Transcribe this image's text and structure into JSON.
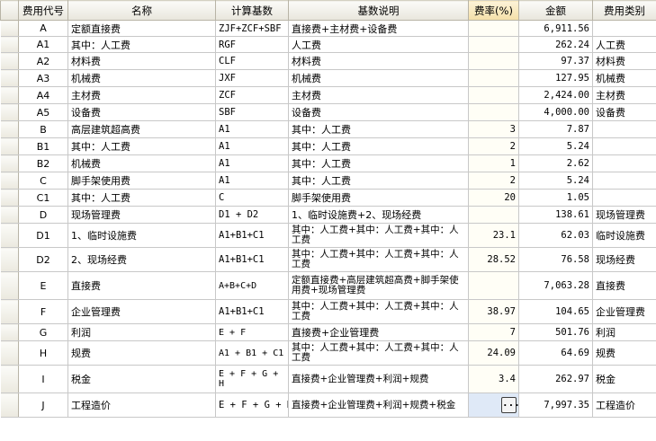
{
  "headers": {
    "code": "费用代号",
    "name": "名称",
    "base": "计算基数",
    "desc": "基数说明",
    "rate": "费率(%)",
    "amount": "金额",
    "category": "费用类别"
  },
  "rows": [
    {
      "code": "A",
      "name": "定额直接费",
      "base": "ZJF+ZCF+SBF",
      "desc": "直接费+主材费+设备费",
      "rate": "",
      "amount": "6,911.56",
      "category": ""
    },
    {
      "code": "A1",
      "name": "其中：人工费",
      "base": "RGF",
      "desc": "人工费",
      "rate": "",
      "amount": "262.24",
      "category": "人工费"
    },
    {
      "code": "A2",
      "name": "材料费",
      "base": "CLF",
      "desc": "材料费",
      "rate": "",
      "amount": "97.37",
      "category": "材料费"
    },
    {
      "code": "A3",
      "name": "机械费",
      "base": "JXF",
      "desc": "机械费",
      "rate": "",
      "amount": "127.95",
      "category": "机械费"
    },
    {
      "code": "A4",
      "name": "主材费",
      "base": "ZCF",
      "desc": "主材费",
      "rate": "",
      "amount": "2,424.00",
      "category": "主材费"
    },
    {
      "code": "A5",
      "name": "设备费",
      "base": "SBF",
      "desc": "设备费",
      "rate": "",
      "amount": "4,000.00",
      "category": "设备费"
    },
    {
      "code": "B",
      "name": "高层建筑超高费",
      "base": "A1",
      "desc": "其中：人工费",
      "rate": "3",
      "amount": "7.87",
      "category": ""
    },
    {
      "code": "B1",
      "name": "其中：人工费",
      "base": "A1",
      "desc": "其中：人工费",
      "rate": "2",
      "amount": "5.24",
      "category": ""
    },
    {
      "code": "B2",
      "name": "机械费",
      "base": "A1",
      "desc": "其中：人工费",
      "rate": "1",
      "amount": "2.62",
      "category": ""
    },
    {
      "code": "C",
      "name": "脚手架使用费",
      "base": "A1",
      "desc": "其中：人工费",
      "rate": "2",
      "amount": "5.24",
      "category": ""
    },
    {
      "code": "C1",
      "name": "其中：人工费",
      "base": "C",
      "desc": "脚手架使用费",
      "rate": "20",
      "amount": "1.05",
      "category": ""
    },
    {
      "code": "D",
      "name": "现场管理费",
      "base": "D1 + D2",
      "desc": "1、临时设施费+2、现场经费",
      "rate": "",
      "amount": "138.61",
      "category": "现场管理费"
    },
    {
      "code": "D1",
      "name": "1、临时设施费",
      "base": "A1+B1+C1",
      "desc": "其中：人工费+其中：人工费+其中：人工费",
      "rate": "23.1",
      "amount": "62.03",
      "category": "临时设施费"
    },
    {
      "code": "D2",
      "name": "2、现场经费",
      "base": "A1+B1+C1",
      "desc": "其中：人工费+其中：人工费+其中：人工费",
      "rate": "28.52",
      "amount": "76.58",
      "category": "现场经费"
    },
    {
      "code": "E",
      "name": "直接费",
      "base": "A+B+C+D",
      "desc": "定额直接费+高层建筑超高费+脚手架使用费+现场管理费",
      "rate": "",
      "amount": "7,063.28",
      "category": "直接费"
    },
    {
      "code": "F",
      "name": "企业管理费",
      "base": "A1+B1+C1",
      "desc": "其中：人工费+其中：人工费+其中：人工费",
      "rate": "38.97",
      "amount": "104.65",
      "category": "企业管理费"
    },
    {
      "code": "G",
      "name": "利润",
      "base": "E + F",
      "desc": "直接费+企业管理费",
      "rate": "7",
      "amount": "501.76",
      "category": "利润"
    },
    {
      "code": "H",
      "name": "规费",
      "base": "A1 + B1 + C1",
      "desc": "其中：人工费+其中：人工费+其中：人工费",
      "rate": "24.09",
      "amount": "64.69",
      "category": "规费"
    },
    {
      "code": "I",
      "name": "税金",
      "base": "E + F + G + H",
      "desc": "直接费+企业管理费+利润+规费",
      "rate": "3.4",
      "amount": "262.97",
      "category": "税金"
    },
    {
      "code": "J",
      "name": "工程造价",
      "base": "E + F + G + H + I",
      "desc": "直接费+企业管理费+利润+规费+税金",
      "rate": "",
      "amount": "7,997.35",
      "category": "工程造价"
    }
  ],
  "ellipsis_button": "..."
}
